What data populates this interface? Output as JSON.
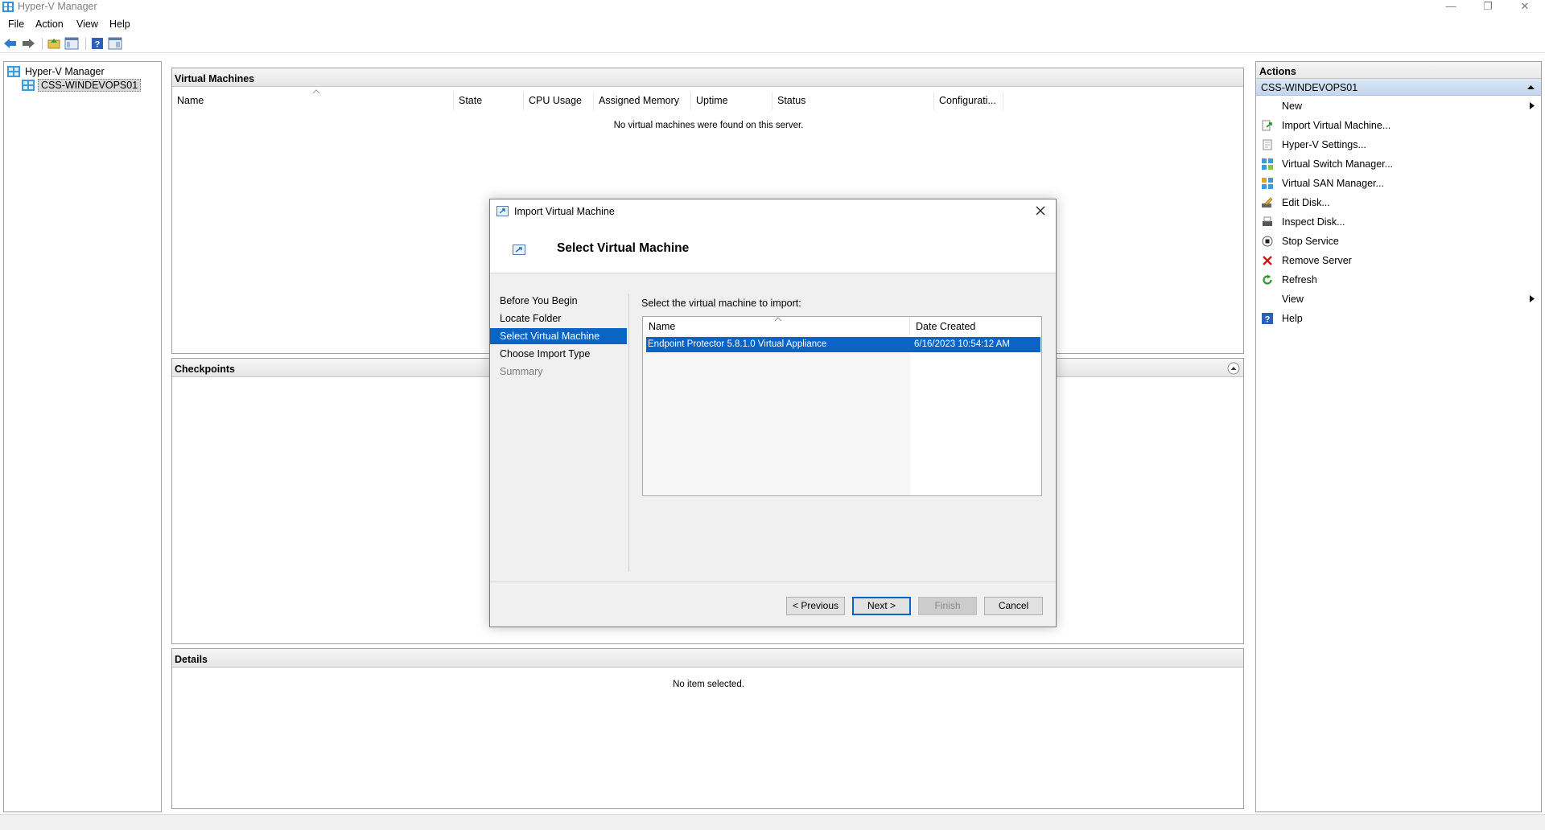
{
  "window": {
    "title": "Hyper-V Manager",
    "minimize_glyph": "—",
    "restore_glyph": "❐",
    "close_glyph": "✕"
  },
  "menu": {
    "file": "File",
    "action": "Action",
    "view": "View",
    "help": "Help"
  },
  "toolbar": {
    "icons": [
      "back-arrow-icon",
      "forward-arrow-icon",
      "up-folder-icon",
      "show-hide-console-tree-icon",
      "help-icon",
      "show-hide-action-pane-icon"
    ]
  },
  "tree": {
    "root": "Hyper-V Manager",
    "server": "CSS-WINDEVOPS01"
  },
  "vm_pane": {
    "title": "Virtual Machines",
    "columns": [
      "Name",
      "State",
      "CPU Usage",
      "Assigned Memory",
      "Uptime",
      "Status",
      "Configurati..."
    ],
    "empty_message": "No virtual machines were found on this server."
  },
  "checkpoints_pane": {
    "title": "Checkpoints"
  },
  "details_pane": {
    "title": "Details",
    "empty_message": "No item selected."
  },
  "actions": {
    "title": "Actions",
    "server": "CSS-WINDEVOPS01",
    "items": [
      {
        "label": "New",
        "icon": "none",
        "submenu": true
      },
      {
        "label": "Import Virtual Machine...",
        "icon": "import-vm-icon"
      },
      {
        "label": "Hyper-V Settings...",
        "icon": "settings-page-icon"
      },
      {
        "label": "Virtual Switch Manager...",
        "icon": "virtual-switch-icon"
      },
      {
        "label": "Virtual SAN Manager...",
        "icon": "virtual-san-icon"
      },
      {
        "label": "Edit Disk...",
        "icon": "edit-disk-icon"
      },
      {
        "label": "Inspect Disk...",
        "icon": "inspect-disk-icon"
      },
      {
        "label": "Stop Service",
        "icon": "stop-service-icon"
      },
      {
        "label": "Remove Server",
        "icon": "remove-x-icon"
      },
      {
        "label": "Refresh",
        "icon": "refresh-icon"
      },
      {
        "label": "View",
        "icon": "none",
        "submenu": true
      },
      {
        "label": "Help",
        "icon": "help-icon"
      }
    ]
  },
  "dialog": {
    "title": "Import Virtual Machine",
    "heading": "Select Virtual Machine",
    "steps": [
      {
        "label": "Before You Begin",
        "state": "normal"
      },
      {
        "label": "Locate Folder",
        "state": "normal"
      },
      {
        "label": "Select Virtual Machine",
        "state": "current"
      },
      {
        "label": "Choose Import Type",
        "state": "normal"
      },
      {
        "label": "Summary",
        "state": "disabled"
      }
    ],
    "prompt": "Select the virtual machine to import:",
    "list_columns": [
      "Name",
      "Date Created"
    ],
    "rows": [
      {
        "name": "Endpoint Protector 5.8.1.0 Virtual Appliance",
        "date_created": "6/16/2023 10:54:12 AM",
        "selected": true
      }
    ],
    "buttons": {
      "previous": "< Previous",
      "next": "Next >",
      "finish": "Finish",
      "cancel": "Cancel"
    }
  },
  "colors": {
    "selection_blue": "#0a64c4",
    "actions_subheader": "#c3d5ee",
    "remove_red": "#d01818",
    "refresh_green": "#2a9a2a"
  }
}
